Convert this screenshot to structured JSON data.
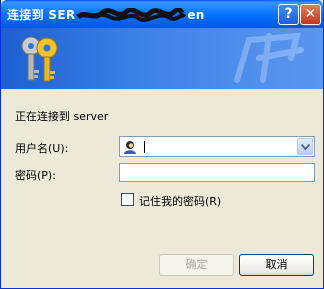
{
  "window": {
    "title": "连接到 SER",
    "title_tail": "en",
    "help_label": "?",
    "close_label": "✕"
  },
  "banner": {
    "icons": [
      "keys-icon",
      "network-icon"
    ]
  },
  "prompt": {
    "connecting_text": "正在连接到 server"
  },
  "form": {
    "username_label": "用户名(U):",
    "username_value": "",
    "password_label": "密码(P):",
    "password_value": "",
    "remember_label": "记住我的密码(R)",
    "remember_checked": false
  },
  "buttons": {
    "ok_label": "确定",
    "cancel_label": "取消"
  },
  "colors": {
    "title_bar": "#0a5ce6",
    "dialog_bg": "#ece9d8",
    "banner": "#2f73df"
  }
}
